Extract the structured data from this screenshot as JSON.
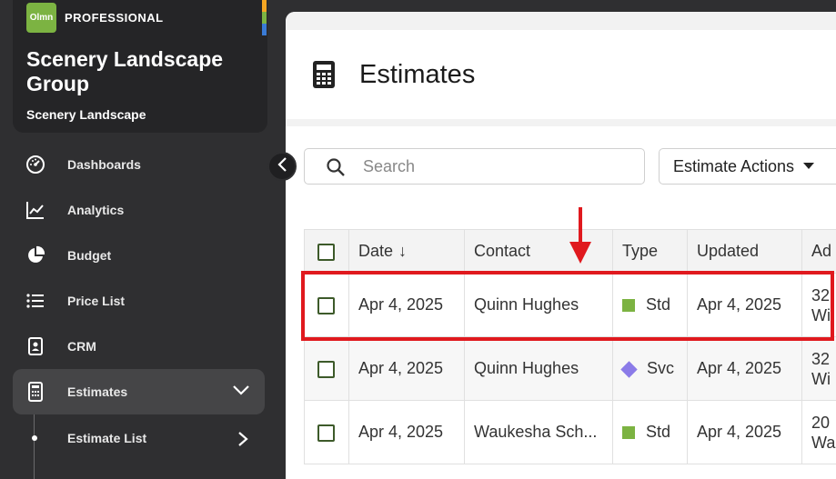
{
  "org": {
    "logo_text": "Olmn",
    "plan": "PROFESSIONAL",
    "name": "Scenery Landscape Group",
    "subtitle": "Scenery Landscape",
    "strip_colors": [
      "#f5a623",
      "#7cb342",
      "#3a7bd5"
    ]
  },
  "sidebar": {
    "items": [
      {
        "label": "Dashboards",
        "icon": "gauge-icon"
      },
      {
        "label": "Analytics",
        "icon": "line-chart-icon"
      },
      {
        "label": "Budget",
        "icon": "pie-chart-icon"
      },
      {
        "label": "Price List",
        "icon": "list-icon"
      },
      {
        "label": "CRM",
        "icon": "contact-card-icon"
      },
      {
        "label": "Estimates",
        "icon": "calculator-icon"
      }
    ],
    "sub_items": [
      {
        "label": "Estimate List"
      }
    ]
  },
  "page": {
    "title": "Estimates",
    "icon": "calculator-icon"
  },
  "search": {
    "placeholder": "Search",
    "value": ""
  },
  "actions": {
    "label": "Estimate Actions"
  },
  "table": {
    "columns": [
      "Date",
      "Contact",
      "Type",
      "Updated",
      "Ad"
    ],
    "rows": [
      {
        "date": "Apr 4, 2025",
        "contact": "Quinn Hughes",
        "type": "Std",
        "updated": "Apr 4, 2025",
        "address1": "32",
        "address2": "Wi"
      },
      {
        "date": "Apr 4, 2025",
        "contact": "Quinn Hughes",
        "type": "Svc",
        "updated": "Apr 4, 2025",
        "address1": "32",
        "address2": "Wi"
      },
      {
        "date": "Apr 4, 2025",
        "contact": "Waukesha Sch...",
        "type": "Std",
        "updated": "Apr 4, 2025",
        "address1": "20",
        "address2": "Wa"
      }
    ]
  },
  "colors": {
    "accent_green": "#7cb342",
    "svc_purple": "#8b7be8",
    "highlight_red": "#e0191e",
    "sidebar_bg": "#2f2f31"
  }
}
